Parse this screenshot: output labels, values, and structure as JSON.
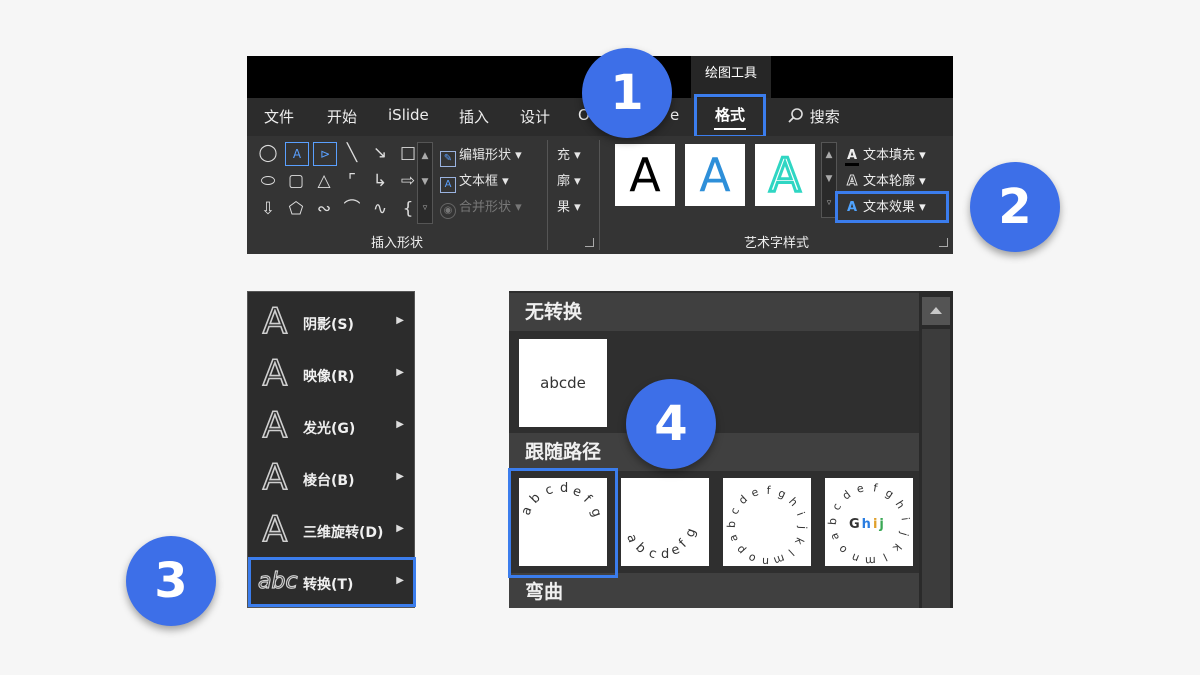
{
  "ribbon": {
    "contextual_tab": "绘图工具",
    "tabs": [
      "文件",
      "开始",
      "iSlide",
      "插入",
      "设计",
      "O"
    ],
    "tab_hidden_suffix": "e",
    "active_tab": "格式",
    "search_label": "搜索",
    "insert_shapes": {
      "edit_shape": "编辑形状",
      "text_box": "文本框",
      "merge_shapes": "合并形状",
      "group_label": "插入形状"
    },
    "fill_outline_effect_trunc": [
      "充",
      "廓",
      "果"
    ],
    "wordart": {
      "tile_letter": "A",
      "text_fill": "文本填充",
      "text_outline": "文本轮廓",
      "text_effect": "文本效果",
      "group_label": "艺术字样式"
    }
  },
  "callouts": [
    "1",
    "2",
    "3",
    "4"
  ],
  "effect_menu": [
    {
      "label": "阴影(S)",
      "glyph": "A"
    },
    {
      "label": "映像(R)",
      "glyph": "A"
    },
    {
      "label": "发光(G)",
      "glyph": "A"
    },
    {
      "label": "棱台(B)",
      "glyph": "A"
    },
    {
      "label": "三维旋转(D)",
      "glyph": "A"
    },
    {
      "label": "转换(T)",
      "glyph": "abc"
    }
  ],
  "gallery": {
    "no_transform": "无转换",
    "follow_path": "跟随路径",
    "warp": "弯曲",
    "sample_text": "abcde"
  },
  "colors": {
    "accent": "#3b7ded",
    "callout": "#3d6fe8",
    "ribbon_bg": "#2c2c2c"
  }
}
